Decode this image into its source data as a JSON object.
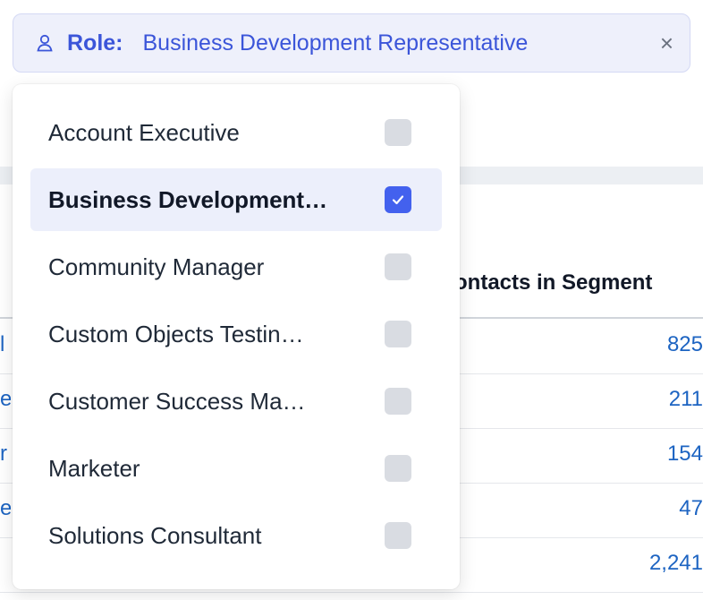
{
  "filter": {
    "key": "Role:",
    "value": "Business Development Representative",
    "close": "×"
  },
  "table": {
    "column_header": "ontacts in Segment",
    "rows": [
      {
        "lead": "l",
        "value": "825"
      },
      {
        "lead": "e",
        "value": "211"
      },
      {
        "lead": "r .",
        "value": "154"
      },
      {
        "lead": "e",
        "value": "47"
      },
      {
        "lead": "",
        "value": "2,241"
      }
    ]
  },
  "dropdown": {
    "options": [
      {
        "label": "Account Executive",
        "checked": false
      },
      {
        "label": "Business Development…",
        "checked": true
      },
      {
        "label": "Community Manager",
        "checked": false
      },
      {
        "label": "Custom Objects Testin…",
        "checked": false
      },
      {
        "label": "Customer Success Ma…",
        "checked": false
      },
      {
        "label": "Marketer",
        "checked": false
      },
      {
        "label": "Solutions Consultant",
        "checked": false
      }
    ]
  },
  "colors": {
    "accent": "#4361ee",
    "link": "#1d64c2",
    "pill_bg": "#eef0fb"
  }
}
